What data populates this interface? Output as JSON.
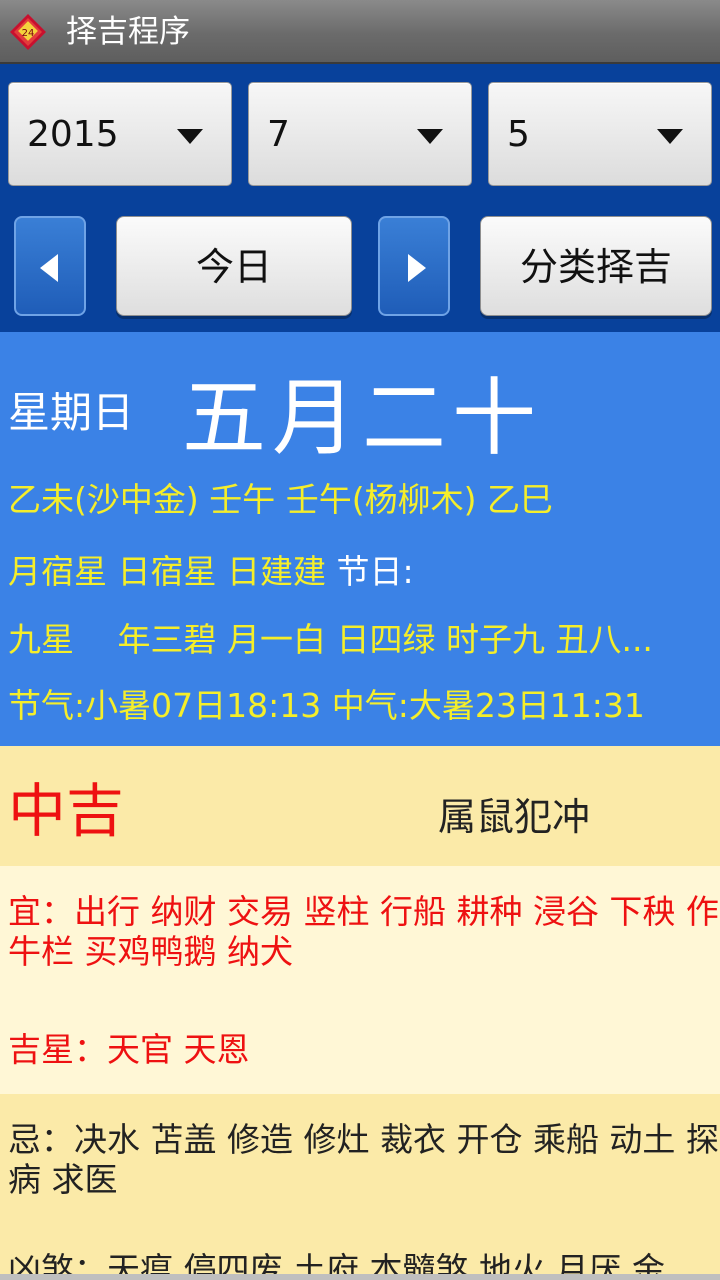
{
  "app": {
    "title": "择吉程序",
    "icon": "calendar-app-icon"
  },
  "date_selector": {
    "year": "2015",
    "month": "7",
    "day": "5"
  },
  "nav": {
    "prev_icon": "left-arrow-icon",
    "today_label": "今日",
    "next_icon": "right-arrow-icon",
    "category_label": "分类择吉"
  },
  "info": {
    "weekday": "星期日",
    "lunar_date": "五月二十",
    "ganzhi": "乙未(沙中金) 壬午 壬午(杨柳木) 乙巳",
    "stars": "月宿星 日宿星 日建建",
    "holiday_label": "节日:",
    "nine_stars": "九星　 年三碧 月一白 日四绿 时子九 丑八...",
    "solar_terms": "节气:小暑07日18:13 中气:大暑23日11:31"
  },
  "fortune": {
    "rating": "中吉",
    "clash": "属鼠犯冲"
  },
  "good": {
    "yi": "宜：出行 纳财 交易 竖柱 行船 耕种 浸谷 下秧 作牛栏 买鸡鸭鹅 纳犬",
    "lucky_stars": "吉星：天官 天恩"
  },
  "bad": {
    "ji": "忌：决水 苫盖 修造 修灶 裁衣 开仓 乘船 动土 探病 求医",
    "evil_stars": "凶煞：天瘟 停四废 土府 本髓煞 地火 月厌 金"
  },
  "colors": {
    "header_blue": "#08419b",
    "info_blue": "#3b82e6",
    "info_yellow": "#f5ee2a",
    "good_red": "#ee1111",
    "panel_yellow": "#fbeaa8"
  }
}
